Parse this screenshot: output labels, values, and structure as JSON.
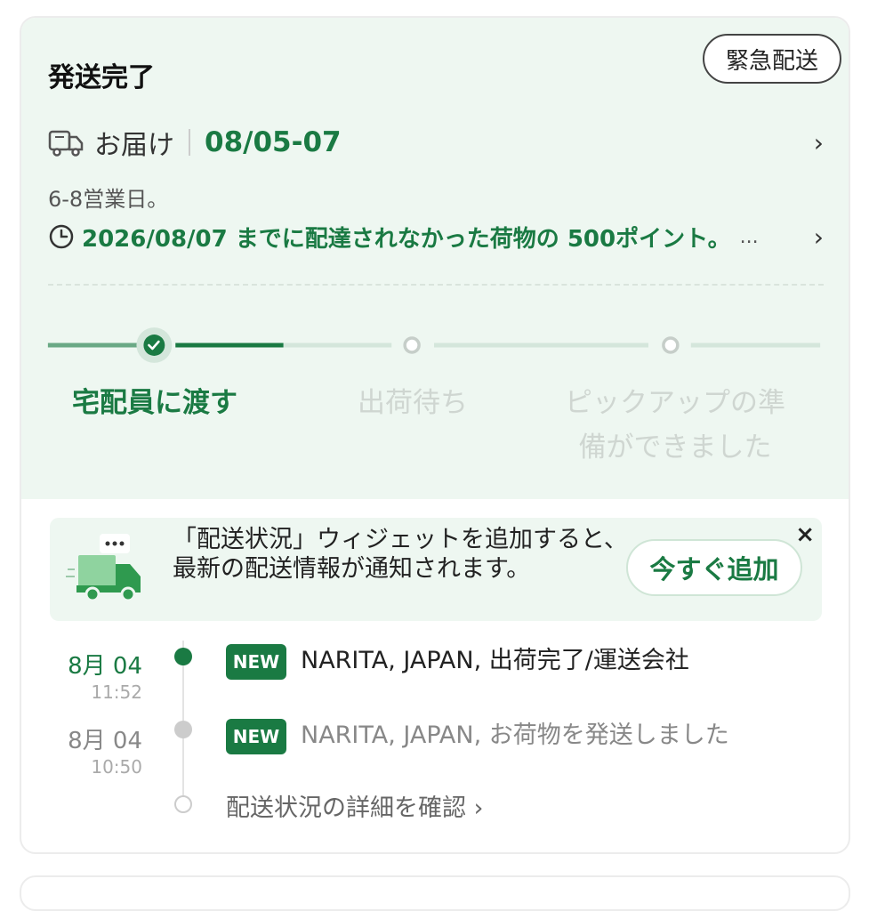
{
  "status": {
    "title": "発送完了",
    "urgent_label": "緊急配送"
  },
  "delivery": {
    "label": "お届け",
    "date": "08/05-07",
    "business_days": "6-8営業日。",
    "promise": "2026/08/07 までに配達されなかった荷物の 500ポイント。",
    "ellipsis": "..."
  },
  "progress": {
    "stages": [
      {
        "label": "宅配員に渡す",
        "state": "done"
      },
      {
        "label": "出荷待ち",
        "state": "pending"
      },
      {
        "label": "ピックアップの準備ができました",
        "state": "pending"
      }
    ],
    "stage3_lines": [
      "ピックアップの準",
      "備ができました"
    ]
  },
  "widget_banner": {
    "text": "「配送状況」ウィジェットを追加すると、最新の配送情報が通知されます。",
    "add_label": "今すぐ追加",
    "close_glyph": "×"
  },
  "timeline": {
    "events": [
      {
        "date": "8月 04",
        "time": "11:52",
        "badge": "NEW",
        "text": "NARITA, JAPAN, 出荷完了/運送会社",
        "active": true
      },
      {
        "date": "8月 04",
        "time": "10:50",
        "badge": "NEW",
        "text": "NARITA, JAPAN, お荷物を発送しました",
        "active": false
      }
    ],
    "details_label": "配送状況の詳細を確認 ›"
  },
  "colors": {
    "accent": "#1a7a43",
    "panel": "#eef7f1",
    "inactive": "#cfd6d1"
  }
}
